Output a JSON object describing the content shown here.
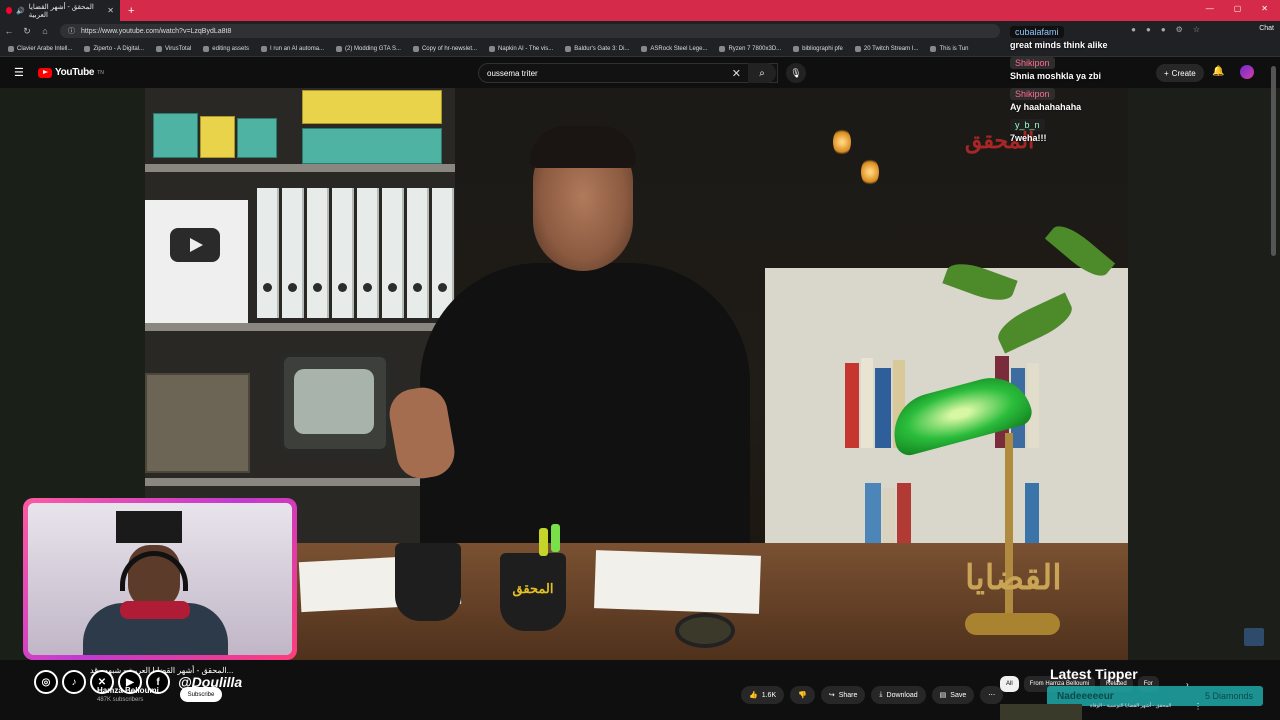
{
  "browser": {
    "tab_title": "المحقق - أشهر القضايا العربية",
    "new_tab": "+",
    "url": "https://www.youtube.com/watch?v=LzqBydLa8t8",
    "chat_button": "Chat",
    "bookmarks": [
      "Clavier Arabe Intell...",
      "Ziperto - A Digital...",
      "VirusTotal",
      "editing assets",
      "I run an AI automa...",
      "(2) Modding GTA S...",
      "Copy of hr-newslet...",
      "Napkin AI - The vis...",
      "Baldur's Gate 3: Di...",
      "ASRock Steel Lege...",
      "Ryzen 7 7800x3D...",
      "bibliographi pfe",
      "20 Twitch Stream I...",
      "This is Tun"
    ]
  },
  "youtube": {
    "logo_text": "YouTube",
    "logo_sup": "TN",
    "search_value": "oussema triter",
    "create_label": "Create"
  },
  "chat": [
    {
      "user": "cubalafami",
      "message": "great minds think alike"
    },
    {
      "user": "Shikipon",
      "message": "Shnia moshkla ya zbi"
    },
    {
      "user": "Shikipon",
      "message": "Ay haahahahaha"
    },
    {
      "user": "y_b_n",
      "message": "7weha!!!"
    }
  ],
  "video": {
    "title": "المحقق - أشهر القضايا العربية - شبهه وقد...",
    "channel": "Hamza Belloumi",
    "subscribers": "487K subscribers",
    "subscribe_label": "Subscribe",
    "wall_logo": "المحقق",
    "cup_label": "المحقق",
    "watermark": "القضايا"
  },
  "actions": {
    "likes": "1.6K",
    "share": "Share",
    "download": "Download",
    "save": "Save"
  },
  "overlay": {
    "handle": "@Doulilla",
    "latest_tipper_label": "Latest Tipper",
    "tipper_name": "Nadeeeeeur",
    "tipper_amount": "5 Diamonds"
  },
  "related_chips": [
    "All",
    "From Hamza Belloumi",
    "Related",
    "For"
  ],
  "related_video_title": "المحقق - أشهر القضايا التونسية - الوفاة"
}
